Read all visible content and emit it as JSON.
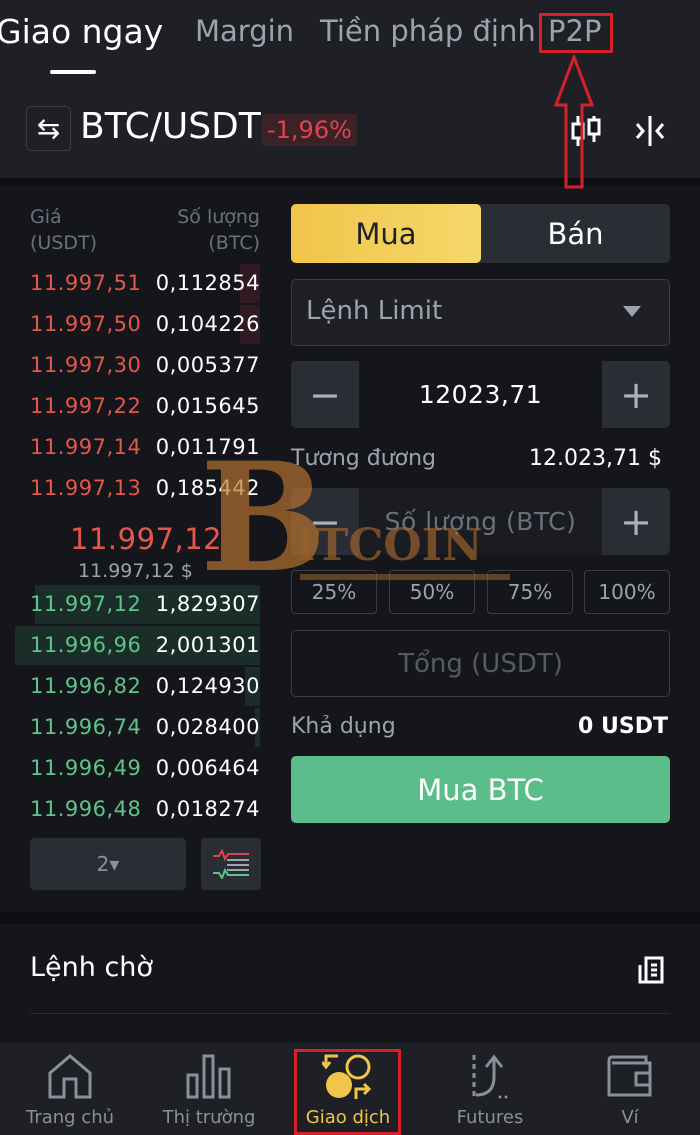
{
  "top_tabs": [
    {
      "label": "Giao ngay",
      "active": true
    },
    {
      "label": "Margin",
      "active": false
    },
    {
      "label": "Tiền pháp định",
      "active": false
    },
    {
      "label": "P2P",
      "active": false,
      "annotated": true
    }
  ],
  "pair": {
    "swap_icon": "⇆",
    "name": "BTC/USDT",
    "change": "-1,96%"
  },
  "order_book": {
    "price_header": "Giá\n(USDT)",
    "price_header_l1": "Giá",
    "price_header_l2": "(USDT)",
    "qty_header_l1": "Số lượng",
    "qty_header_l2": "(BTC)",
    "asks": [
      {
        "price": "11.997,51",
        "qty": "0,112854",
        "depth": 0.08
      },
      {
        "price": "11.997,50",
        "qty": "0,104226",
        "depth": 0.08
      },
      {
        "price": "11.997,30",
        "qty": "0,005377",
        "depth": 0.0
      },
      {
        "price": "11.997,22",
        "qty": "0,015645",
        "depth": 0.0
      },
      {
        "price": "11.997,14",
        "qty": "0,011791",
        "depth": 0.0
      },
      {
        "price": "11.997,13",
        "qty": "0,185442",
        "depth": 0.0
      }
    ],
    "mid_price": "11.997,12",
    "mid_usd": "11.997,12 $",
    "bids": [
      {
        "price": "11.997,12",
        "qty": "1,829307",
        "depth": 0.92
      },
      {
        "price": "11.996,96",
        "qty": "2,001301",
        "depth": 1.0
      },
      {
        "price": "11.996,82",
        "qty": "0,124930",
        "depth": 0.06
      },
      {
        "price": "11.996,74",
        "qty": "0,028400",
        "depth": 0.02
      },
      {
        "price": "11.996,49",
        "qty": "0,006464",
        "depth": 0.0
      },
      {
        "price": "11.996,48",
        "qty": "0,018274",
        "depth": 0.0
      }
    ],
    "precision": "2▾"
  },
  "order_form": {
    "buy_label": "Mua",
    "sell_label": "Bán",
    "order_type": "Lệnh Limit",
    "price_value": "12023,71",
    "minus": "−",
    "plus": "+",
    "equivalent_label": "Tương đương",
    "equivalent_value": "12.023,71 $",
    "amount_placeholder": "Số lượng (BTC)",
    "percent_options": [
      "25%",
      "50%",
      "75%",
      "100%"
    ],
    "total_placeholder": "Tổng (USDT)",
    "available_label": "Khả dụng",
    "available_value": "0 USDT",
    "submit_label": "Mua BTC"
  },
  "pending": {
    "title": "Lệnh chờ"
  },
  "bottom_nav": [
    {
      "label": "Trang chủ",
      "icon": "home-icon",
      "active": false
    },
    {
      "label": "Thị trường",
      "icon": "markets-icon",
      "active": false
    },
    {
      "label": "Giao dịch",
      "icon": "trade-icon",
      "active": true
    },
    {
      "label": "Futures",
      "icon": "futures-icon",
      "active": false
    },
    {
      "label": "Ví",
      "icon": "wallet-icon",
      "active": false
    }
  ],
  "colors": {
    "accent_yellow": "#f0c54a",
    "ask_red": "#e4574a",
    "bid_green": "#5fc48a",
    "buy_button": "#5bbd8a",
    "annotation_red": "#d6202a"
  }
}
